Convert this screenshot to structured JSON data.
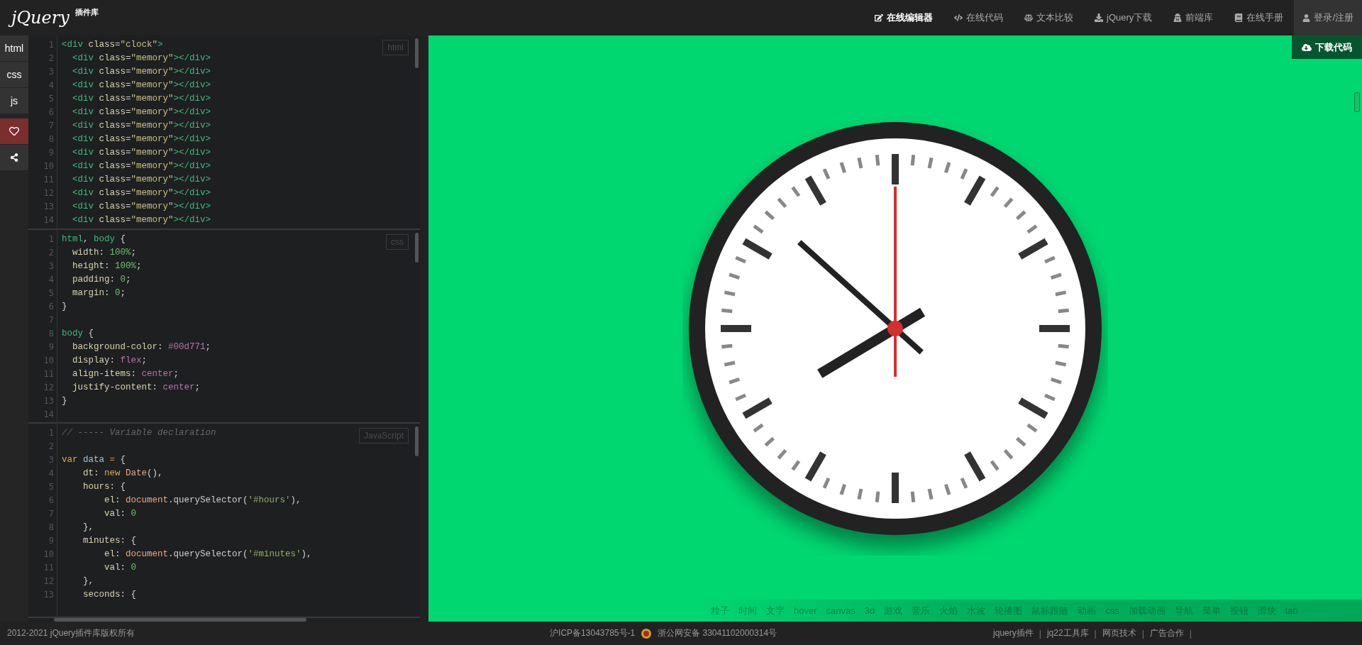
{
  "header": {
    "logo": {
      "word": "jQuery",
      "badge": "插件库"
    },
    "nav": [
      {
        "label": "在线编辑器",
        "kind": "edit",
        "selected": true
      },
      {
        "label": "在线代码",
        "kind": "code",
        "selected": false
      },
      {
        "label": "文本比较",
        "kind": "scale",
        "selected": false
      },
      {
        "label": "jQuery下载",
        "kind": "download",
        "selected": false
      },
      {
        "label": "前端库",
        "kind": "library",
        "selected": false
      },
      {
        "label": "在线手册",
        "kind": "book",
        "selected": false
      }
    ],
    "account": {
      "label": "登录/注册"
    }
  },
  "sidebar": {
    "tabs": [
      {
        "label": "html"
      },
      {
        "label": "css"
      },
      {
        "label": "js"
      }
    ]
  },
  "editors": [
    {
      "label": "html",
      "lines": [
        {
          "n": "1",
          "tokens": [
            {
              "kind": "tag",
              "text": "<div"
            },
            {
              "kind": "attr",
              "text": " class"
            },
            {
              "kind": "plain",
              "text": "="
            },
            {
              "kind": "str",
              "text": "\"clock\""
            },
            {
              "kind": "tag",
              "text": ">"
            }
          ]
        },
        {
          "n": "2",
          "tokens": [
            {
              "kind": "tag",
              "text": "  <div"
            },
            {
              "kind": "attr",
              "text": " class"
            },
            {
              "kind": "plain",
              "text": "="
            },
            {
              "kind": "str",
              "text": "\"memory\""
            },
            {
              "kind": "tag",
              "text": "></div>"
            }
          ]
        },
        {
          "n": "3",
          "tokens": [
            {
              "kind": "tag",
              "text": "  <div"
            },
            {
              "kind": "attr",
              "text": " class"
            },
            {
              "kind": "plain",
              "text": "="
            },
            {
              "kind": "str",
              "text": "\"memory\""
            },
            {
              "kind": "tag",
              "text": "></div>"
            }
          ]
        },
        {
          "n": "4",
          "tokens": [
            {
              "kind": "tag",
              "text": "  <div"
            },
            {
              "kind": "attr",
              "text": " class"
            },
            {
              "kind": "plain",
              "text": "="
            },
            {
              "kind": "str",
              "text": "\"memory\""
            },
            {
              "kind": "tag",
              "text": "></div>"
            }
          ]
        },
        {
          "n": "5",
          "tokens": [
            {
              "kind": "tag",
              "text": "  <div"
            },
            {
              "kind": "attr",
              "text": " class"
            },
            {
              "kind": "plain",
              "text": "="
            },
            {
              "kind": "str",
              "text": "\"memory\""
            },
            {
              "kind": "tag",
              "text": "></div>"
            }
          ]
        },
        {
          "n": "6",
          "tokens": [
            {
              "kind": "tag",
              "text": "  <div"
            },
            {
              "kind": "attr",
              "text": " class"
            },
            {
              "kind": "plain",
              "text": "="
            },
            {
              "kind": "str",
              "text": "\"memory\""
            },
            {
              "kind": "tag",
              "text": "></div>"
            }
          ]
        },
        {
          "n": "7",
          "tokens": [
            {
              "kind": "tag",
              "text": "  <div"
            },
            {
              "kind": "attr",
              "text": " class"
            },
            {
              "kind": "plain",
              "text": "="
            },
            {
              "kind": "str",
              "text": "\"memory\""
            },
            {
              "kind": "tag",
              "text": "></div>"
            }
          ]
        },
        {
          "n": "8",
          "tokens": [
            {
              "kind": "tag",
              "text": "  <div"
            },
            {
              "kind": "attr",
              "text": " class"
            },
            {
              "kind": "plain",
              "text": "="
            },
            {
              "kind": "str",
              "text": "\"memory\""
            },
            {
              "kind": "tag",
              "text": "></div>"
            }
          ]
        },
        {
          "n": "9",
          "tokens": [
            {
              "kind": "tag",
              "text": "  <div"
            },
            {
              "kind": "attr",
              "text": " class"
            },
            {
              "kind": "plain",
              "text": "="
            },
            {
              "kind": "str",
              "text": "\"memory\""
            },
            {
              "kind": "tag",
              "text": "></div>"
            }
          ]
        },
        {
          "n": "10",
          "tokens": [
            {
              "kind": "tag",
              "text": "  <div"
            },
            {
              "kind": "attr",
              "text": " class"
            },
            {
              "kind": "plain",
              "text": "="
            },
            {
              "kind": "str",
              "text": "\"memory\""
            },
            {
              "kind": "tag",
              "text": "></div>"
            }
          ]
        },
        {
          "n": "11",
          "tokens": [
            {
              "kind": "tag",
              "text": "  <div"
            },
            {
              "kind": "attr",
              "text": " class"
            },
            {
              "kind": "plain",
              "text": "="
            },
            {
              "kind": "str",
              "text": "\"memory\""
            },
            {
              "kind": "tag",
              "text": "></div>"
            }
          ]
        },
        {
          "n": "12",
          "tokens": [
            {
              "kind": "tag",
              "text": "  <div"
            },
            {
              "kind": "attr",
              "text": " class"
            },
            {
              "kind": "plain",
              "text": "="
            },
            {
              "kind": "str",
              "text": "\"memory\""
            },
            {
              "kind": "tag",
              "text": "></div>"
            }
          ]
        },
        {
          "n": "13",
          "tokens": [
            {
              "kind": "tag",
              "text": "  <div"
            },
            {
              "kind": "attr",
              "text": " class"
            },
            {
              "kind": "plain",
              "text": "="
            },
            {
              "kind": "str",
              "text": "\"memory\""
            },
            {
              "kind": "tag",
              "text": "></div>"
            }
          ]
        },
        {
          "n": "14",
          "tokens": [
            {
              "kind": "tag",
              "text": "  <div"
            },
            {
              "kind": "attr",
              "text": " class"
            },
            {
              "kind": "plain",
              "text": "="
            },
            {
              "kind": "str",
              "text": "\"memory\""
            },
            {
              "kind": "tag",
              "text": "></div>"
            }
          ]
        }
      ]
    },
    {
      "label": "css",
      "lines": [
        {
          "n": "1",
          "tokens": [
            {
              "kind": "tag",
              "text": "html"
            },
            {
              "kind": "plain",
              "text": ", "
            },
            {
              "kind": "tag",
              "text": "body"
            },
            {
              "kind": "plain",
              "text": " {"
            }
          ]
        },
        {
          "n": "2",
          "tokens": [
            {
              "kind": "attr",
              "text": "  width"
            },
            {
              "kind": "plain",
              "text": ": "
            },
            {
              "kind": "num",
              "text": "100%"
            },
            {
              "kind": "plain",
              "text": ";"
            }
          ]
        },
        {
          "n": "3",
          "tokens": [
            {
              "kind": "attr",
              "text": "  height"
            },
            {
              "kind": "plain",
              "text": ": "
            },
            {
              "kind": "num",
              "text": "100%"
            },
            {
              "kind": "plain",
              "text": ";"
            }
          ]
        },
        {
          "n": "4",
          "tokens": [
            {
              "kind": "attr",
              "text": "  padding"
            },
            {
              "kind": "plain",
              "text": ": "
            },
            {
              "kind": "num",
              "text": "0"
            },
            {
              "kind": "plain",
              "text": ";"
            }
          ]
        },
        {
          "n": "5",
          "tokens": [
            {
              "kind": "attr",
              "text": "  margin"
            },
            {
              "kind": "plain",
              "text": ": "
            },
            {
              "kind": "num",
              "text": "0"
            },
            {
              "kind": "plain",
              "text": ";"
            }
          ]
        },
        {
          "n": "6",
          "tokens": [
            {
              "kind": "plain",
              "text": "}"
            }
          ]
        },
        {
          "n": "7"
        },
        {
          "n": "8",
          "tokens": [
            {
              "kind": "tag",
              "text": "body"
            },
            {
              "kind": "plain",
              "text": " {"
            }
          ]
        },
        {
          "n": "9",
          "tokens": [
            {
              "kind": "attr",
              "text": "  background-color"
            },
            {
              "kind": "plain",
              "text": ": "
            },
            {
              "kind": "atom",
              "text": "#00d771"
            },
            {
              "kind": "plain",
              "text": ";"
            }
          ]
        },
        {
          "n": "10",
          "tokens": [
            {
              "kind": "attr",
              "text": "  display"
            },
            {
              "kind": "plain",
              "text": ": "
            },
            {
              "kind": "atom",
              "text": "flex"
            },
            {
              "kind": "plain",
              "text": ";"
            }
          ]
        },
        {
          "n": "11",
          "tokens": [
            {
              "kind": "attr",
              "text": "  align-items"
            },
            {
              "kind": "plain",
              "text": ": "
            },
            {
              "kind": "atom",
              "text": "center"
            },
            {
              "kind": "plain",
              "text": ";"
            }
          ]
        },
        {
          "n": "12",
          "tokens": [
            {
              "kind": "attr",
              "text": "  justify-content"
            },
            {
              "kind": "plain",
              "text": ": "
            },
            {
              "kind": "atom",
              "text": "center"
            },
            {
              "kind": "plain",
              "text": ";"
            }
          ]
        },
        {
          "n": "13",
          "tokens": [
            {
              "kind": "plain",
              "text": "}"
            }
          ]
        },
        {
          "n": "14"
        }
      ]
    },
    {
      "label": "JavaScript",
      "lines": [
        {
          "n": "1",
          "tokens": [
            {
              "kind": "comment",
              "text": "// ----- Variable declaration"
            }
          ]
        },
        {
          "n": "2"
        },
        {
          "n": "3",
          "tokens": [
            {
              "kind": "kw",
              "text": "var"
            },
            {
              "kind": "var",
              "text": " data"
            },
            {
              "kind": "op",
              "text": " ="
            },
            {
              "kind": "plain",
              "text": " {"
            }
          ]
        },
        {
          "n": "4",
          "tokens": [
            {
              "kind": "attr",
              "text": "    dt"
            },
            {
              "kind": "plain",
              "text": ": "
            },
            {
              "kind": "kw",
              "text": "new"
            },
            {
              "kind": "fn",
              "text": " Date"
            },
            {
              "kind": "plain",
              "text": "(),"
            }
          ]
        },
        {
          "n": "5",
          "tokens": [
            {
              "kind": "attr",
              "text": "    hours"
            },
            {
              "kind": "plain",
              "text": ": {"
            }
          ]
        },
        {
          "n": "6",
          "tokens": [
            {
              "kind": "attr",
              "text": "        el"
            },
            {
              "kind": "plain",
              "text": ": "
            },
            {
              "kind": "fn",
              "text": "document"
            },
            {
              "kind": "plain",
              "text": ".querySelector("
            },
            {
              "kind": "jstr",
              "text": "'#hours'"
            },
            {
              "kind": "plain",
              "text": "),"
            }
          ]
        },
        {
          "n": "7",
          "tokens": [
            {
              "kind": "attr",
              "text": "        val"
            },
            {
              "kind": "plain",
              "text": ": "
            },
            {
              "kind": "num",
              "text": "0"
            }
          ]
        },
        {
          "n": "8",
          "tokens": [
            {
              "kind": "plain",
              "text": "    },"
            }
          ]
        },
        {
          "n": "9",
          "tokens": [
            {
              "kind": "attr",
              "text": "    minutes"
            },
            {
              "kind": "plain",
              "text": ": {"
            }
          ]
        },
        {
          "n": "10",
          "tokens": [
            {
              "kind": "attr",
              "text": "        el"
            },
            {
              "kind": "plain",
              "text": ": "
            },
            {
              "kind": "fn",
              "text": "document"
            },
            {
              "kind": "plain",
              "text": ".querySelector("
            },
            {
              "kind": "jstr",
              "text": "'#minutes'"
            },
            {
              "kind": "plain",
              "text": "),"
            }
          ]
        },
        {
          "n": "11",
          "tokens": [
            {
              "kind": "attr",
              "text": "        val"
            },
            {
              "kind": "plain",
              "text": ": "
            },
            {
              "kind": "num",
              "text": "0"
            }
          ]
        },
        {
          "n": "12",
          "tokens": [
            {
              "kind": "plain",
              "text": "    },"
            }
          ]
        },
        {
          "n": "13",
          "tokens": [
            {
              "kind": "attr",
              "text": "    seconds"
            },
            {
              "kind": "plain",
              "text": ": {"
            }
          ]
        }
      ]
    }
  ],
  "preview": {
    "download": "下载代码",
    "tags": [
      "粒子",
      "时间",
      "文字",
      "hover",
      "canvas",
      "3d",
      "游戏",
      "音乐",
      "火焰",
      "水波",
      "轮播图",
      "鼠标跟随",
      "动画",
      "css",
      "加载动画",
      "导航",
      "菜单",
      "按钮",
      "滑块",
      "tab"
    ]
  },
  "footer": {
    "copyright": "2012-2021 jQuery插件库版权所有",
    "icp": "沪ICP备13043785号-1",
    "police": "浙公网安备 33041102000314号",
    "links": [
      {
        "label": "jquery插件",
        "separator": "|"
      },
      {
        "label": "jq22工具库",
        "separator": "|"
      },
      {
        "label": "网页技术",
        "separator": "|"
      },
      {
        "label": "广告合作",
        "separator": "|"
      }
    ]
  }
}
